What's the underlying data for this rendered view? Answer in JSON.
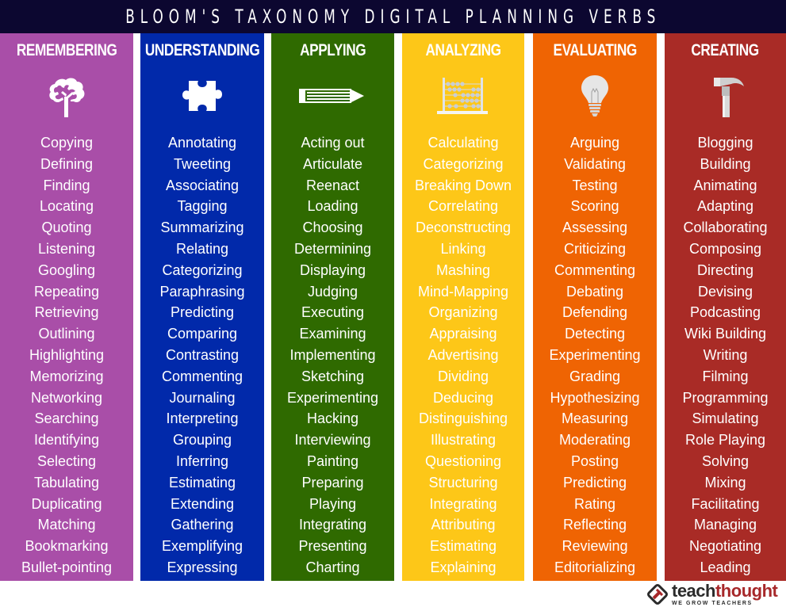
{
  "title": "BLOOM'S TAXONOMY DIGITAL PLANNING VERBS",
  "colors": {
    "title_bg": "#0c0730",
    "remembering": "#a94ea8",
    "understanding": "#0129aa",
    "applying": "#2f6a00",
    "analyzing": "#fdc718",
    "evaluating": "#ef6403",
    "creating": "#a92b26"
  },
  "columns": [
    {
      "key": "remembering",
      "header": "REMEMBERING",
      "icon": "brain-icon",
      "verbs": [
        "Copying",
        "Defining",
        "Finding",
        "Locating",
        "Quoting",
        "Listening",
        "Googling",
        "Repeating",
        "Retrieving",
        "Outlining",
        "Highlighting",
        "Memorizing",
        "Networking",
        "Searching",
        "Identifying",
        "Selecting",
        "Tabulating",
        "Duplicating",
        "Matching",
        "Bookmarking",
        "Bullet-pointing"
      ]
    },
    {
      "key": "understanding",
      "header": "UNDERSTANDING",
      "icon": "puzzle-piece-icon",
      "verbs": [
        "Annotating",
        "Tweeting",
        "Associating",
        "Tagging",
        "Summarizing",
        "Relating",
        "Categorizing",
        "Paraphrasing",
        "Predicting",
        "Comparing",
        "Contrasting",
        "Commenting",
        "Journaling",
        "Interpreting",
        "Grouping",
        "Inferring",
        "Estimating",
        "Extending",
        "Gathering",
        "Exemplifying",
        "Expressing"
      ]
    },
    {
      "key": "applying",
      "header": "APPLYING",
      "icon": "pencil-icon",
      "verbs": [
        "Acting out",
        "Articulate",
        "Reenact",
        "Loading",
        "Choosing",
        "Determining",
        "Displaying",
        "Judging",
        "Executing",
        "Examining",
        "Implementing",
        "Sketching",
        "Experimenting",
        "Hacking",
        "Interviewing",
        "Painting",
        "Preparing",
        "Playing",
        "Integrating",
        "Presenting",
        "Charting"
      ]
    },
    {
      "key": "analyzing",
      "header": "ANALYZING",
      "icon": "abacus-icon",
      "verbs": [
        "Calculating",
        "Categorizing",
        "Breaking Down",
        "Correlating",
        "Deconstructing",
        "Linking",
        "Mashing",
        "Mind-Mapping",
        "Organizing",
        "Appraising",
        "Advertising",
        "Dividing",
        "Deducing",
        "Distinguishing",
        "Illustrating",
        "Questioning",
        "Structuring",
        "Integrating",
        "Attributing",
        "Estimating",
        "Explaining"
      ]
    },
    {
      "key": "evaluating",
      "header": "EVALUATING",
      "icon": "lightbulb-icon",
      "verbs": [
        "Arguing",
        "Validating",
        "Testing",
        "Scoring",
        "Assessing",
        "Criticizing",
        "Commenting",
        "Debating",
        "Defending",
        "Detecting",
        "Experimenting",
        "Grading",
        "Hypothesizing",
        "Measuring",
        "Moderating",
        "Posting",
        "Predicting",
        "Rating",
        "Reflecting",
        "Reviewing",
        "Editorializing"
      ]
    },
    {
      "key": "creating",
      "header": "CREATING",
      "icon": "hammer-icon",
      "verbs": [
        "Blogging",
        "Building",
        "Animating",
        "Adapting",
        "Collaborating",
        "Composing",
        "Directing",
        "Devising",
        "Podcasting",
        "Wiki Building",
        "Writing",
        "Filming",
        "Programming",
        "Simulating",
        "Role Playing",
        "Solving",
        "Mixing",
        "Facilitating",
        "Managing",
        "Negotiating",
        "Leading"
      ]
    }
  ],
  "logo": {
    "name_part1": "teach",
    "name_part2": "thought",
    "tagline": "WE GROW TEACHERS"
  }
}
